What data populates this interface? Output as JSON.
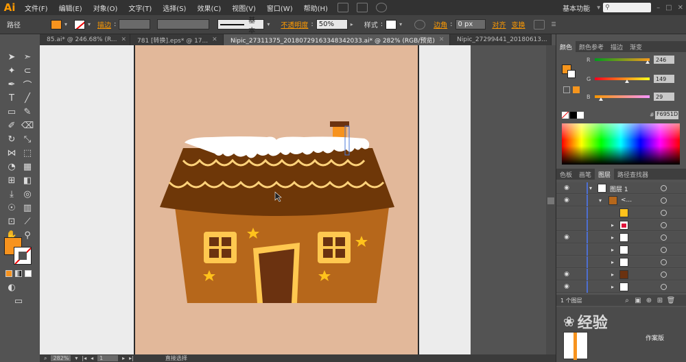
{
  "app": {
    "logo": "Ai",
    "workspace": "基本功能"
  },
  "menu": [
    "文件(F)",
    "编辑(E)",
    "对象(O)",
    "文字(T)",
    "选择(S)",
    "效果(C)",
    "视图(V)",
    "窗口(W)",
    "帮助(H)"
  ],
  "control": {
    "selection_label": "路径",
    "stroke_link": "描边",
    "stroke_style": "基本",
    "opacity_link": "不透明度",
    "opacity_value": "50%",
    "style_label": "样式",
    "corner_label": "边角",
    "corner_value": "0 px",
    "align_link": "对齐",
    "transform_link": "变换",
    "fill_color": "#f7931e",
    "stroke_color": "#ffffff"
  },
  "tabs": [
    {
      "label": "85.ai* @ 246.68% (R...",
      "active": false
    },
    {
      "label": "781 [转换].eps* @ 17...",
      "active": false
    },
    {
      "label": "Nipic_27311375_20180729163348342033.ai* @ 282% (RGB/预览)",
      "active": true
    },
    {
      "label": "Nipic_27299441_20180613...",
      "active": false
    }
  ],
  "status": {
    "zoom": "282%",
    "page": "1",
    "tool": "直接选择"
  },
  "color_panel": {
    "tabs": [
      "颜色",
      "颜色参考",
      "描边",
      "渐变"
    ],
    "channels": [
      {
        "label": "R",
        "value": "246",
        "fraction": 0.965
      },
      {
        "label": "G",
        "value": "149",
        "fraction": 0.584
      },
      {
        "label": "B",
        "value": "29",
        "fraction": 0.114
      }
    ],
    "hex_prefix": "#",
    "hex": "F6951D",
    "fill_color": "#f6951d"
  },
  "layers_panel": {
    "tabs": [
      "色板",
      "画笔",
      "图层",
      "路径查找器"
    ],
    "layer_name": "图层 1",
    "group_name": "<...",
    "count": "1 个图层"
  },
  "watermark": {
    "text": "经验",
    "sub": "作案版"
  }
}
